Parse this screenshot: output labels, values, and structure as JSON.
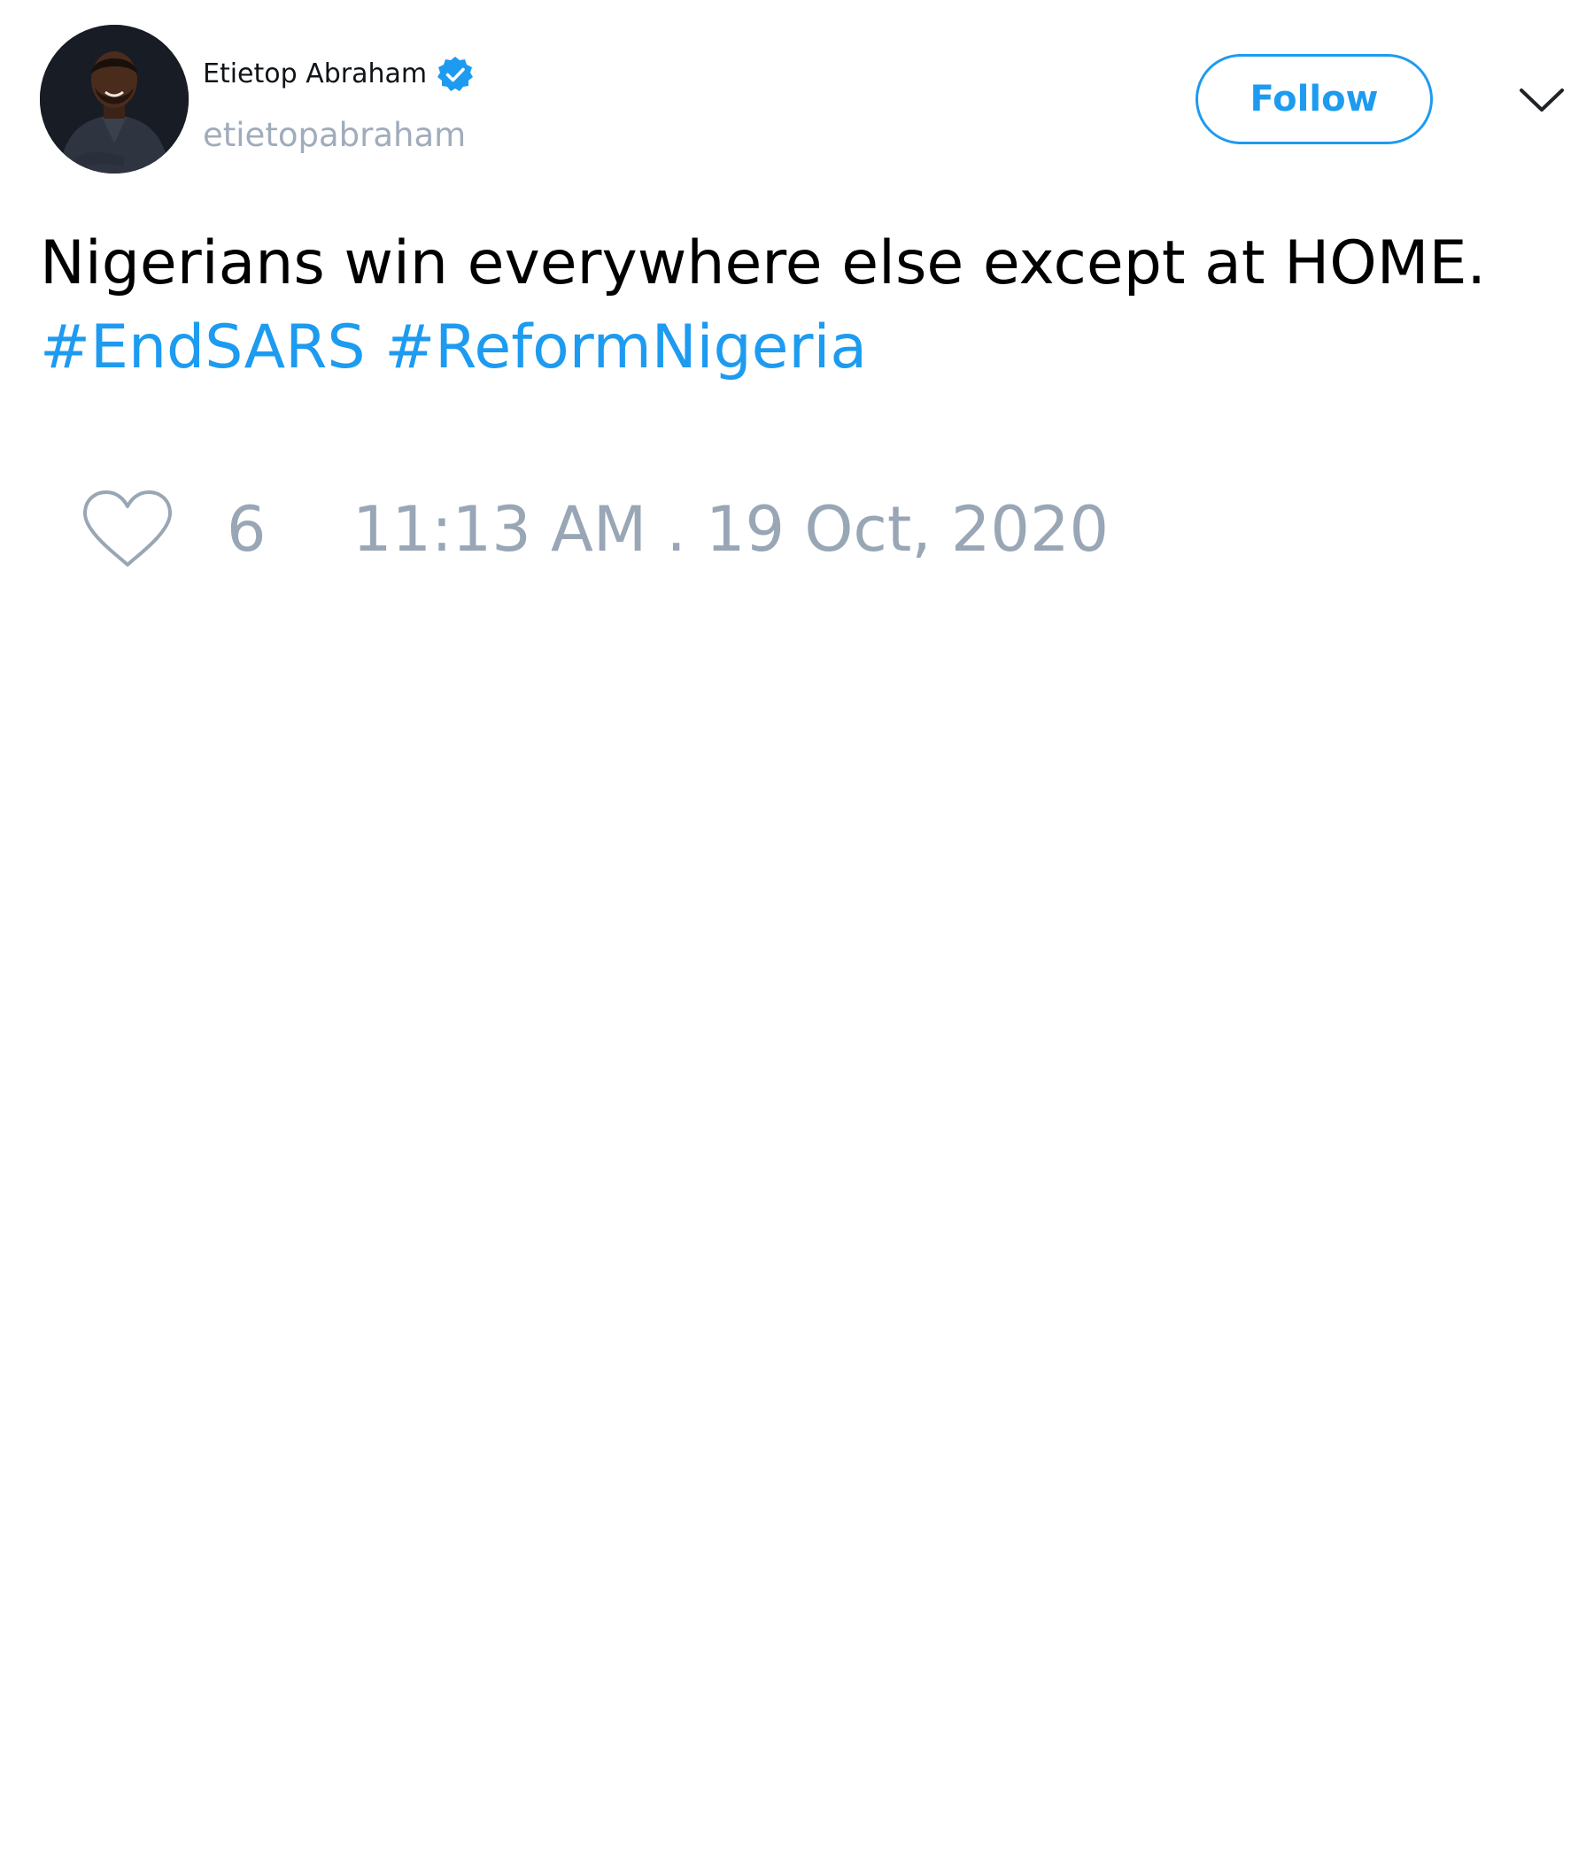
{
  "author": {
    "display_name": "Etietop Abraham",
    "handle": "etietopabraham",
    "verified": true,
    "avatar_description": "portrait photo of the account owner"
  },
  "follow_button": {
    "label": "Follow"
  },
  "tweet": {
    "text_line": "Nigerians win everywhere else except at HOME.",
    "hashtags": [
      "#EndSARS",
      "#ReformNigeria"
    ]
  },
  "engagement": {
    "like_count": "6",
    "timestamp": "11:13 AM . 19 Oct, 2020"
  },
  "icons": {
    "verified": "verified-badge-icon",
    "chevron": "chevron-down-icon",
    "heart": "heart-icon"
  },
  "colors": {
    "accent": "#1d9bf0",
    "muted": "#98a6b6",
    "text": "#000000",
    "background": "#ffffff"
  }
}
